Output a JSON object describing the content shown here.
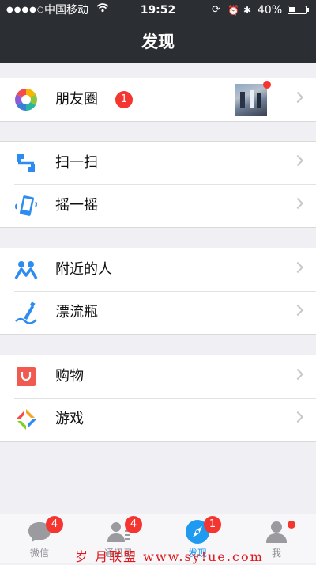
{
  "status_bar": {
    "signal": "●●●●○",
    "carrier": "中国移动",
    "time": "19:52",
    "battery_percent": "40%",
    "battery_level": 0.4
  },
  "nav": {
    "title": "发现"
  },
  "groups": [
    {
      "items": [
        {
          "label": "朋友圈",
          "badge": "1",
          "icon": "moments-icon"
        }
      ]
    },
    {
      "items": [
        {
          "label": "扫一扫",
          "icon": "scan-icon"
        },
        {
          "label": "摇一摇",
          "icon": "shake-icon"
        }
      ]
    },
    {
      "items": [
        {
          "label": "附近的人",
          "icon": "people-nearby-icon"
        },
        {
          "label": "漂流瓶",
          "icon": "drift-bottle-icon"
        }
      ]
    },
    {
      "items": [
        {
          "label": "购物",
          "icon": "shopping-icon"
        },
        {
          "label": "游戏",
          "icon": "games-icon"
        }
      ]
    }
  ],
  "tabs": [
    {
      "label": "微信",
      "badge": "4",
      "icon": "chat-icon"
    },
    {
      "label": "通讯录",
      "badge": "4",
      "icon": "contacts-icon"
    },
    {
      "label": "发现",
      "badge": "1",
      "icon": "discover-icon",
      "active": true
    },
    {
      "label": "我",
      "icon": "me-icon",
      "dot": true
    }
  ],
  "watermark": "岁 月联盟 www.sy!ue.com",
  "colors": {
    "nav_bg": "#2b2e32",
    "badge": "#f43530",
    "active_tab": "#1e9af0",
    "page_bg": "#efeff4"
  }
}
